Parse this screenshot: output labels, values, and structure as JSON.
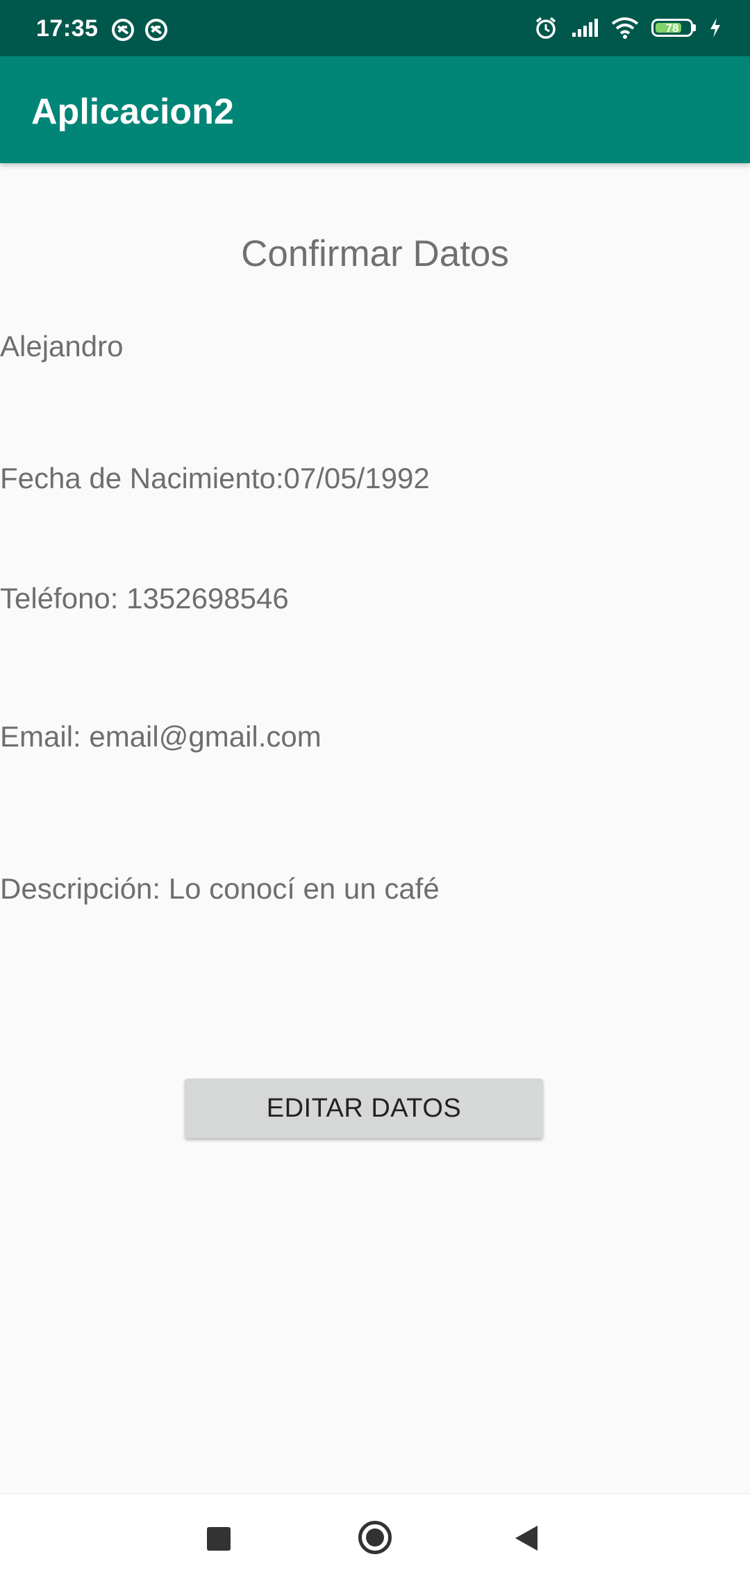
{
  "status_bar": {
    "time": "17:35",
    "battery_level": "78",
    "battery_fraction": 0.78,
    "icons": [
      "notification-icon",
      "notification-icon",
      "alarm-icon",
      "signal-icon",
      "wifi-icon",
      "battery-icon",
      "charging-icon"
    ]
  },
  "app_bar": {
    "title": "Aplicacion2",
    "color": "#008577"
  },
  "main": {
    "heading": "Confirmar Datos",
    "name": "Alejandro",
    "birth_date": "Fecha de Nacimiento:07/05/1992",
    "phone": "Teléfono: 1352698546",
    "email": "Email: email@gmail.com",
    "description": "Descripción: Lo conocí en un café",
    "edit_button_label": "EDITAR DATOS"
  },
  "nav_bar": {
    "buttons": [
      "recents-icon",
      "home-icon",
      "back-icon"
    ]
  }
}
